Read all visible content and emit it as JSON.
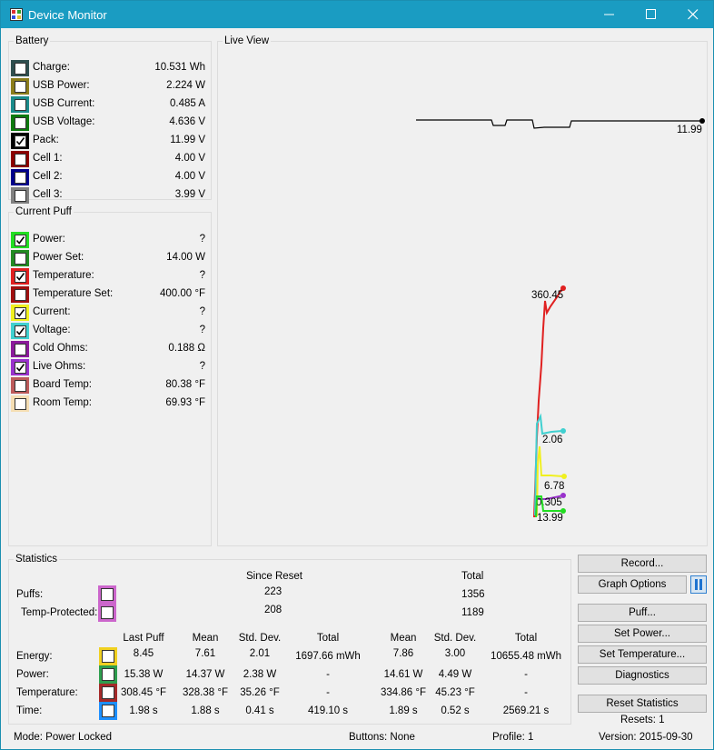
{
  "window": {
    "title": "Device Monitor"
  },
  "battery": {
    "legend": "Battery",
    "rows": [
      {
        "label": "Charge:",
        "value": "10.531 Wh",
        "color": "#2F4F4F",
        "checked": false
      },
      {
        "label": "USB Power:",
        "value": "2.224 W",
        "color": "#8B7D1A",
        "checked": false
      },
      {
        "label": "USB Current:",
        "value": "0.485 A",
        "color": "#1A8B8B",
        "checked": false
      },
      {
        "label": "USB Voltage:",
        "value": "4.636 V",
        "color": "#0E7A0E",
        "checked": false
      },
      {
        "label": "Pack:",
        "value": "11.99 V",
        "color": "#000000",
        "checked": true
      },
      {
        "label": "Cell 1:",
        "value": "4.00 V",
        "color": "#8B0000",
        "checked": false
      },
      {
        "label": "Cell 2:",
        "value": "4.00 V",
        "color": "#00008B",
        "checked": false
      },
      {
        "label": "Cell 3:",
        "value": "3.99 V",
        "color": "#808080",
        "checked": false
      }
    ]
  },
  "current_puff": {
    "legend": "Current Puff",
    "rows": [
      {
        "label": "Power:",
        "value": "?",
        "color": "#22DD22",
        "checked": true
      },
      {
        "label": "Power Set:",
        "value": "14.00 W",
        "color": "#228B22",
        "checked": false
      },
      {
        "label": "Temperature:",
        "value": "?",
        "color": "#E02020",
        "checked": true
      },
      {
        "label": "Temperature Set:",
        "value": "400.00 °F",
        "color": "#A01010",
        "checked": false
      },
      {
        "label": "Current:",
        "value": "?",
        "color": "#F0F020",
        "checked": true
      },
      {
        "label": "Voltage:",
        "value": "?",
        "color": "#40D0D0",
        "checked": true
      },
      {
        "label": "Cold Ohms:",
        "value": "0.188 Ω",
        "color": "#8B1A9B",
        "checked": false
      },
      {
        "label": "Live Ohms:",
        "value": "?",
        "color": "#9932CC",
        "checked": true
      },
      {
        "label": "Board Temp:",
        "value": "80.38 °F",
        "color": "#BC5A5A",
        "checked": false
      },
      {
        "label": "Room Temp:",
        "value": "69.93 °F",
        "color": "#F5DEB3",
        "checked": false
      }
    ]
  },
  "live_view": {
    "legend": "Live View",
    "labels": {
      "pack": "11.99",
      "temperature": "360.45",
      "voltage": "2.06",
      "current": "6.78",
      "ohms": "0.305",
      "power": "13.99"
    }
  },
  "statistics": {
    "legend": "Statistics",
    "since_reset_header": "Since Reset",
    "total_header": "Total",
    "puffs": {
      "label": "Puffs:",
      "since": "223",
      "total": "1356",
      "color": "#CC66CC"
    },
    "temp_protected": {
      "label": "Temp-Protected:",
      "since": "208",
      "total": "1189",
      "color": "#CC66CC"
    },
    "columns": [
      "Last Puff",
      "Mean",
      "Std. Dev.",
      "Total",
      "Mean",
      "Std. Dev.",
      "Total"
    ],
    "rows": [
      {
        "label": "Energy:",
        "color": "#F0D020",
        "values": [
          "8.45",
          "7.61",
          "2.01",
          "1697.66 mWh",
          "7.86",
          "3.00",
          "10655.48 mWh"
        ]
      },
      {
        "label": "Power:",
        "color": "#2E9E4E",
        "values": [
          "15.38 W",
          "14.37 W",
          "2.38 W",
          "-",
          "14.61 W",
          "4.49 W",
          "-"
        ]
      },
      {
        "label": "Temperature:",
        "color": "#A52A2A",
        "values": [
          "308.45 °F",
          "328.38 °F",
          "35.26 °F",
          "-",
          "334.86 °F",
          "45.23 °F",
          "-"
        ]
      },
      {
        "label": "Time:",
        "color": "#1E90FF",
        "values": [
          "1.98 s",
          "1.88 s",
          "0.41 s",
          "419.10 s",
          "1.89 s",
          "0.52 s",
          "2569.21 s"
        ]
      }
    ]
  },
  "buttons": {
    "record": "Record...",
    "graph_options": "Graph Options",
    "puff": "Puff...",
    "set_power": "Set Power...",
    "set_temperature": "Set Temperature...",
    "diagnostics": "Diagnostics",
    "reset_statistics": "Reset Statistics"
  },
  "resets_text": "Resets: 1",
  "status": {
    "mode": "Mode: Power Locked",
    "buttons": "Buttons: None",
    "profile": "Profile: 1",
    "version": "Version: 2015-09-30"
  }
}
